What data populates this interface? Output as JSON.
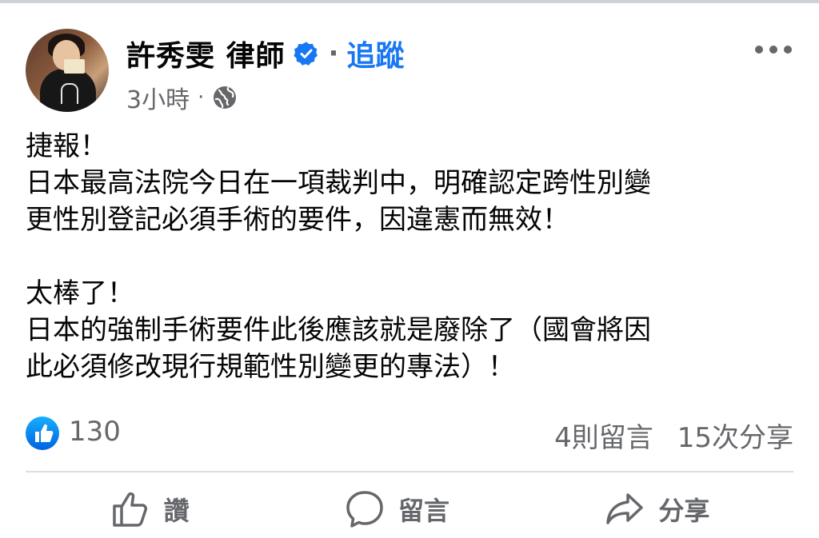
{
  "post": {
    "author": "許秀雯 律師",
    "follow_label": "追蹤",
    "separator": "·",
    "time": "3小時",
    "meta_separator": "·",
    "audience_icon": "globe-icon",
    "more_icon": "more-options-icon",
    "body": {
      "line1": "捷報！",
      "line2": "日本最高法院今日在一項裁判中，明確認定跨性別變",
      "line3": "更性別登記必須手術的要件，因違憲而無效！",
      "line4": "太棒了！",
      "line5": "日本的強制手術要件此後應該就是廢除了（國會將因",
      "line6": "此必須修改現行規範性別變更的專法）！"
    }
  },
  "stats": {
    "like_count": "130",
    "comments": "4則留言",
    "shares": "15次分享"
  },
  "actions": {
    "like_label": "讚",
    "comment_label": "留言",
    "share_label": "分享"
  },
  "colors": {
    "accent": "#1877f2",
    "text_secondary": "#65676b",
    "text_primary": "#050505",
    "divider": "#dadde1"
  }
}
